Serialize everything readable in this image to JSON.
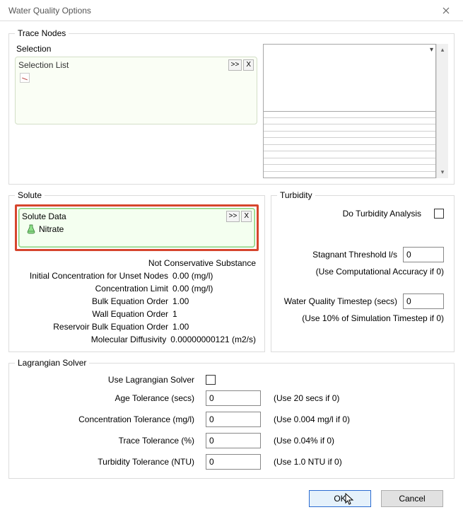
{
  "window": {
    "title": "Water Quality Options"
  },
  "traceNodes": {
    "legend": "Trace Nodes",
    "selectionLabel": "Selection",
    "selectionList": {
      "title": "Selection List",
      "expand": ">>",
      "close": "X"
    },
    "dropdownValue": ""
  },
  "solute": {
    "legend": "Solute",
    "data": {
      "title": "Solute Data",
      "expand": ">>",
      "close": "X",
      "item": "Nitrate"
    },
    "rows": {
      "conservative": {
        "label": "Not Conservative Substance"
      },
      "initConc": {
        "label": "Initial Concentration for Unset Nodes",
        "value": "0.00 (mg/l)"
      },
      "concLimit": {
        "label": "Concentration Limit",
        "value": "0.00 (mg/l)"
      },
      "bulkEq": {
        "label": "Bulk Equation Order",
        "value": "1.00"
      },
      "wallEq": {
        "label": "Wall Equation Order",
        "value": "1"
      },
      "resBulk": {
        "label": "Reservoir Bulk Equation Order",
        "value": "1.00"
      },
      "molDiff": {
        "label": "Molecular Diffusivity",
        "value": "0.00000000121 (m2/s)"
      }
    }
  },
  "turbidity": {
    "legend": "Turbidity",
    "doAnalysis": "Do Turbidity Analysis",
    "stagnantLabel": "Stagnant Threshold l/s",
    "stagnantValue": "0",
    "stagnantNote": "(Use Computational Accuracy if 0)",
    "wqTimestepLabel": "Water Quality Timestep (secs)",
    "wqTimestepValue": "0",
    "wqTimestepNote": "(Use 10% of Simulation Timestep if 0)"
  },
  "lagrangian": {
    "legend": "Lagrangian Solver",
    "useLabel": "Use Lagrangian Solver",
    "rows": {
      "age": {
        "label": "Age Tolerance (secs)",
        "value": "0",
        "hint": "(Use 20 secs if 0)"
      },
      "conc": {
        "label": "Concentration Tolerance (mg/l)",
        "value": "0",
        "hint": "(Use 0.004 mg/l if 0)"
      },
      "trace": {
        "label": "Trace Tolerance (%)",
        "value": "0",
        "hint": "(Use 0.04% if 0)"
      },
      "turb": {
        "label": "Turbidity Tolerance (NTU)",
        "value": "0",
        "hint": "(Use 1.0 NTU if 0)"
      }
    }
  },
  "footer": {
    "ok": "OK",
    "cancel": "Cancel"
  }
}
